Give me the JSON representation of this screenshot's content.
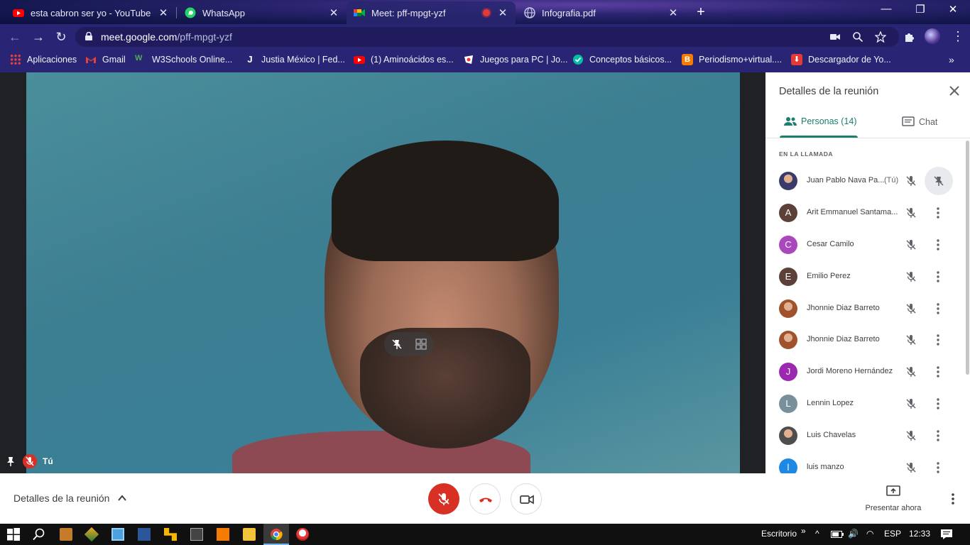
{
  "tabs": [
    {
      "title": "esta cabron ser yo - YouTube",
      "favicon": "youtube-icon"
    },
    {
      "title": "WhatsApp",
      "favicon": "whatsapp-icon"
    },
    {
      "title": "Meet: pff-mpgt-yzf",
      "favicon": "meet-icon",
      "active": true,
      "recording": true
    },
    {
      "title": "Infografia.pdf",
      "favicon": "globe-icon"
    }
  ],
  "address": {
    "domain": "meet.google.com",
    "path": "/pff-mpgt-yzf"
  },
  "bookmarks": [
    {
      "label": "Aplicaciones",
      "icon": "apps-grid-icon",
      "color": "#4285f4"
    },
    {
      "label": "Gmail",
      "icon": "gmail-icon",
      "color": "#ea4335"
    },
    {
      "label": "W3Schools Online...",
      "icon": "w3schools-icon",
      "color": "#4caf50"
    },
    {
      "label": "Justia México | Fed...",
      "icon": "justia-icon",
      "color": "#1a3d7c"
    },
    {
      "label": "(1) Aminoácidos es...",
      "icon": "youtube-icon",
      "color": "#ff0000"
    },
    {
      "label": "Juegos para PC | Jo...",
      "icon": "games-icon",
      "color": "#ffffff"
    },
    {
      "label": "Conceptos básicos...",
      "icon": "shield-check-icon",
      "color": "#00bfa5"
    },
    {
      "label": "Periodismo+virtual....",
      "icon": "blogger-icon",
      "color": "#f57c00"
    },
    {
      "label": "Descargador de Yo...",
      "icon": "download-icon",
      "color": "#e53935"
    }
  ],
  "video": {
    "self_label": "Tú"
  },
  "panel": {
    "title": "Detalles de la reunión",
    "tab_people": "Personas (14)",
    "tab_chat": "Chat",
    "section": "EN LA LLAMADA",
    "you_suffix": "(Tú)",
    "participants": [
      {
        "name": "Juan Pablo Nava Pa...",
        "initial": "",
        "color": "#3b3b6b",
        "photo": true
      },
      {
        "name": "Arit Emmanuel Santama...",
        "initial": "A",
        "color": "#5d4037"
      },
      {
        "name": "Cesar Camilo",
        "initial": "C",
        "color": "#ab47bc"
      },
      {
        "name": "Emilio Perez",
        "initial": "E",
        "color": "#5d4037"
      },
      {
        "name": "Jhonnie Diaz Barreto",
        "initial": "",
        "color": "#a0522d",
        "photo": true
      },
      {
        "name": "Jhonnie Diaz Barreto",
        "initial": "",
        "color": "#a0522d",
        "photo": true
      },
      {
        "name": "Jordi Moreno Hernández",
        "initial": "J",
        "color": "#9c27b0"
      },
      {
        "name": "Lennin Lopez",
        "initial": "L",
        "color": "#78909c"
      },
      {
        "name": "Luis Chavelas",
        "initial": "",
        "color": "#4e4e4e",
        "photo": true
      },
      {
        "name": "luis manzo",
        "initial": "l",
        "color": "#1e88e5"
      }
    ]
  },
  "callbar": {
    "details": "Detalles de la reunión",
    "present": "Presentar ahora"
  },
  "taskbar": {
    "desktop": "Escritorio",
    "lang": "ESP",
    "time": "12:33"
  }
}
